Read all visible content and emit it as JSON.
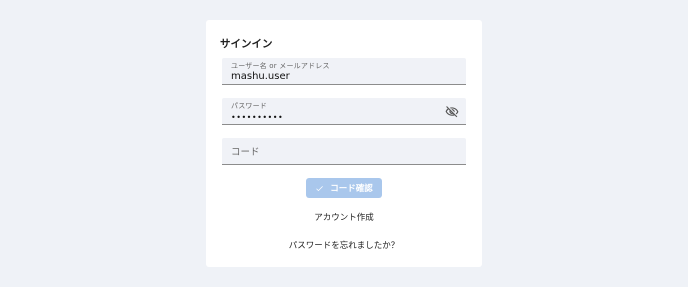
{
  "signin": {
    "title": "サインイン",
    "username": {
      "label": "ユーザー名 or メールアドレス",
      "value": "mashu.user"
    },
    "password": {
      "label": "パスワード",
      "value": "••••••••••"
    },
    "code": {
      "placeholder": "コード",
      "value": ""
    },
    "submit_label": "コード確認",
    "create_account_label": "アカウント作成",
    "forgot_password_label": "パスワードを忘れましたか？"
  },
  "icons": {
    "visibility_toggle": "eye-off-icon",
    "submit": "check-icon"
  },
  "colors": {
    "background": "#eff2f7",
    "field": "#f0f2f7",
    "button": "#a9c7ec"
  }
}
